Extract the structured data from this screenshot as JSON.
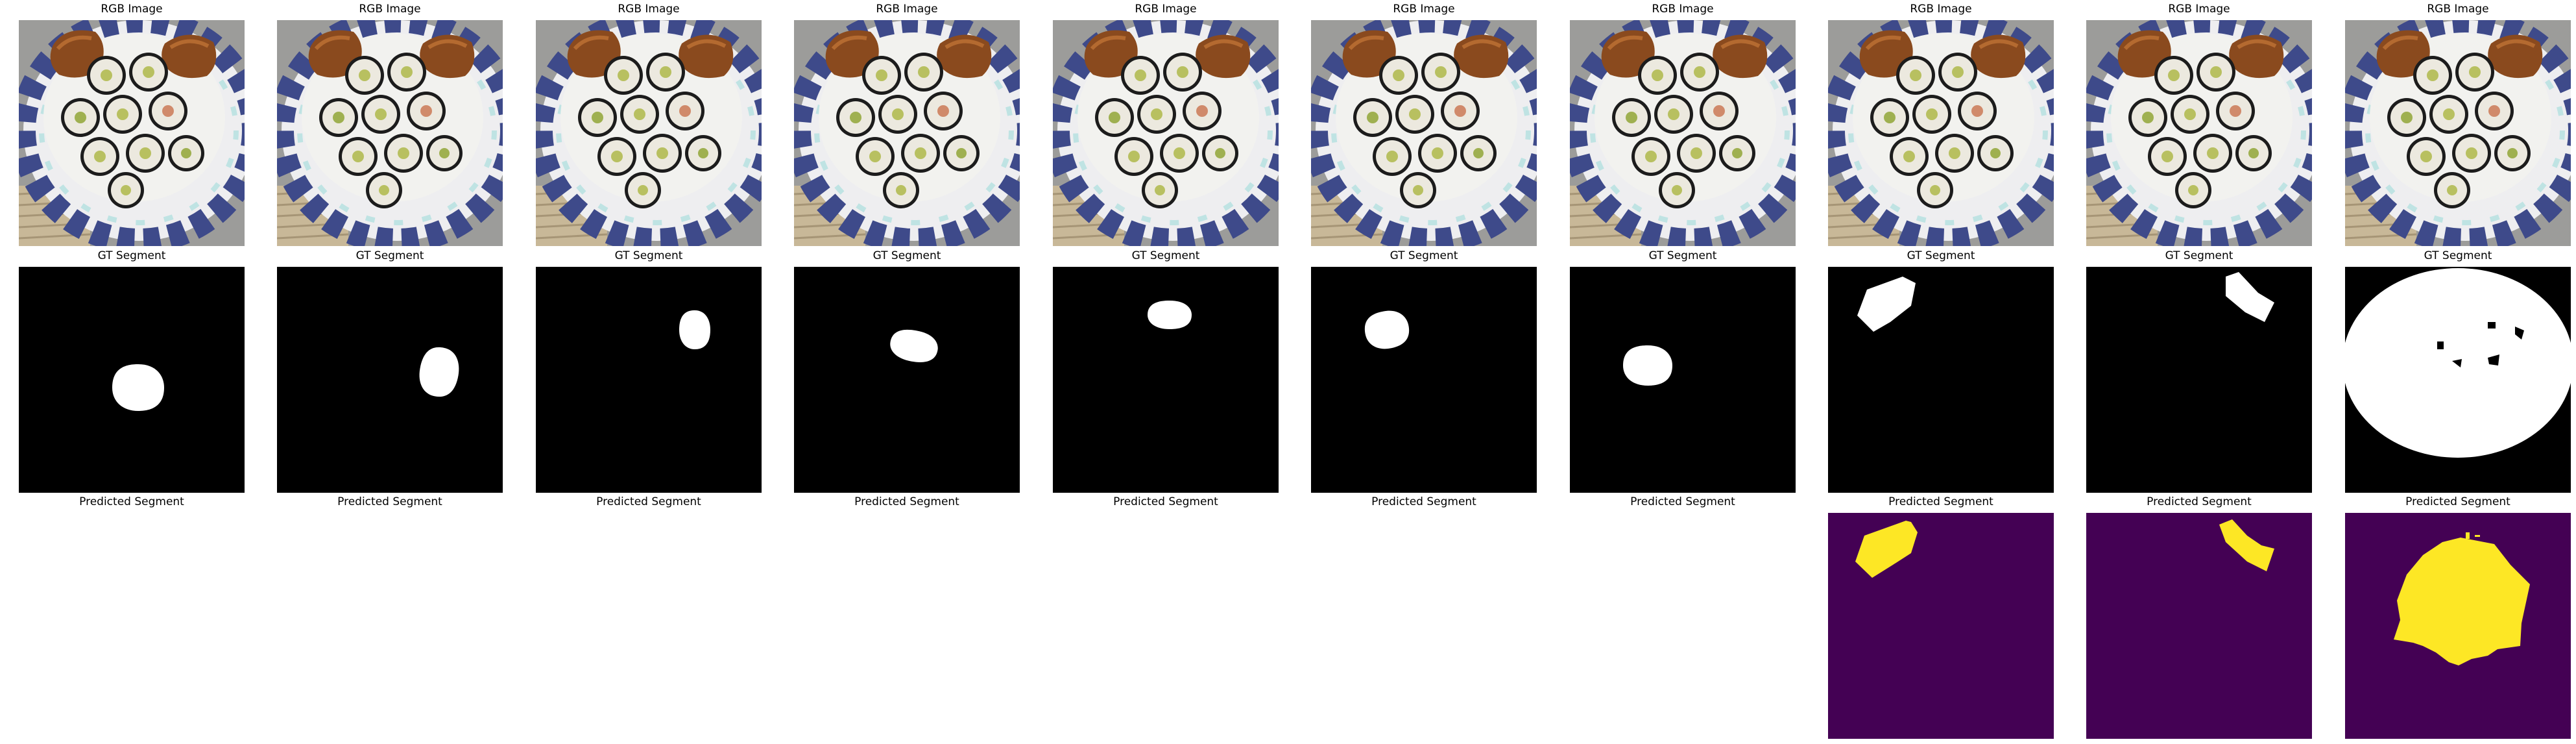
{
  "figure": {
    "columns": 10,
    "row_titles": {
      "rgb": "RGB Image",
      "gt": "GT Segment",
      "pred": "Predicted Segment"
    }
  },
  "colors": {
    "background": "#ffffff",
    "gt_background": "#000000",
    "gt_foreground": "#ffffff",
    "pred_background": "#440154",
    "pred_foreground": "#fde725",
    "plate_rim": "#3e4a8a",
    "plate_center": "#f2f2ef",
    "rice": "#ece9df",
    "nori": "#1c1c1c",
    "tofu_skin": "#8a4a1e",
    "countertop": "#9c9c9a",
    "bamboo_mat": "#c8b898"
  },
  "predictions_visible_in_columns": [
    8,
    9,
    10
  ]
}
